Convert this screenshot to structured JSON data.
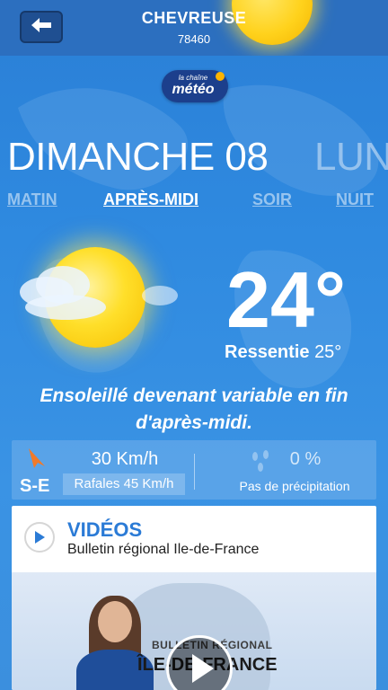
{
  "header": {
    "city": "CHEVREUSE",
    "zip": "78460",
    "back_icon": "arrow-left-icon"
  },
  "logo": {
    "top": "la chaîne",
    "main": "météo"
  },
  "days": {
    "current": "DIMANCHE 08",
    "next": "LUN"
  },
  "periods": [
    {
      "label": "MATIN",
      "active": false
    },
    {
      "label": "APRÈS-MIDI",
      "active": true
    },
    {
      "label": "SOIR",
      "active": false
    },
    {
      "label": "NUIT",
      "active": false
    }
  ],
  "weather": {
    "icon": "sun-with-cloud-icon",
    "temperature": "24°",
    "feels_label": "Ressentie",
    "feels_value": "25°",
    "description": "Ensoleillé devenant variable en fin d'après-midi."
  },
  "wind": {
    "direction": "S-E",
    "speed": "30 Km/h",
    "gusts": "Rafales 45 Km/h",
    "arrow_color": "#f07a2a"
  },
  "precipitation": {
    "value": "0 %",
    "label": "Pas de précipitation"
  },
  "videos": {
    "title": "VIDÉOS",
    "subtitle": "Bulletin régional Ile-de-France",
    "thumb_line1": "BULLETIN RÉGIONAL",
    "thumb_line2": "ÎLE-DE-FRANCE"
  },
  "colors": {
    "accent_blue": "#2b7bd6",
    "header_blue": "#2c6fbf"
  }
}
